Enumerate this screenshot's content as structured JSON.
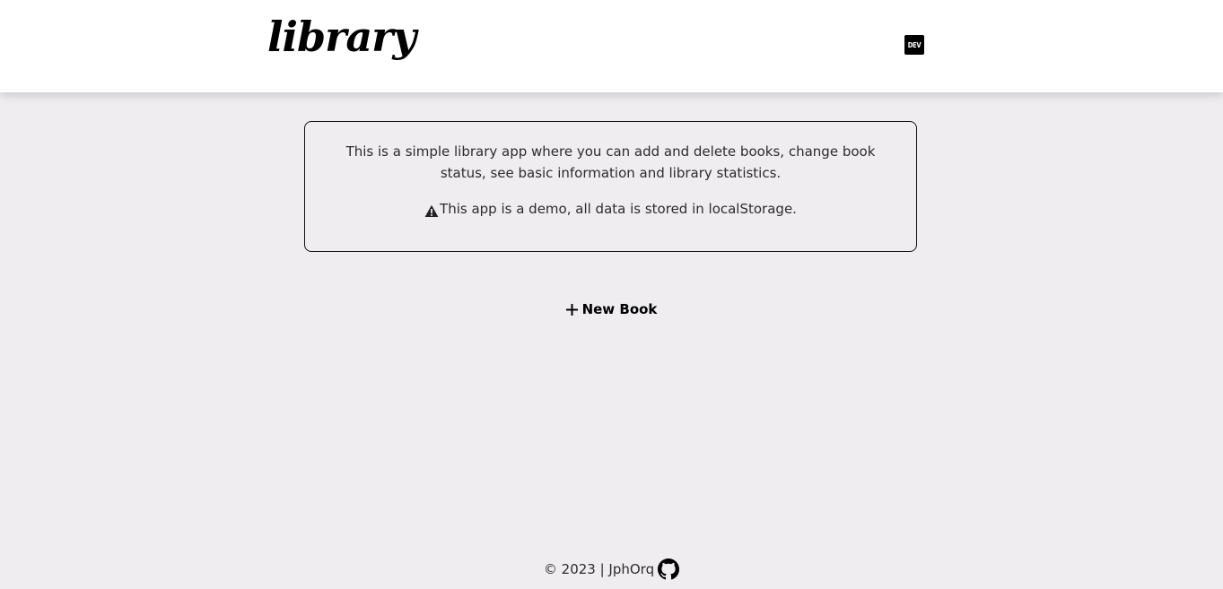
{
  "header": {
    "logo_text": "library",
    "dev_badge_label": "DEV"
  },
  "info": {
    "description": "This is a simple library app where you can add and delete books, change book status, see basic information and library statistics.",
    "warning": "This app is a demo, all data is stored in localStorage.",
    "warning_icon": "warning-triangle-icon"
  },
  "actions": {
    "new_book_label": "New Book",
    "new_book_icon": "plus-icon"
  },
  "footer": {
    "text": "© 2023 | JphOrq",
    "github_icon": "github-icon"
  }
}
